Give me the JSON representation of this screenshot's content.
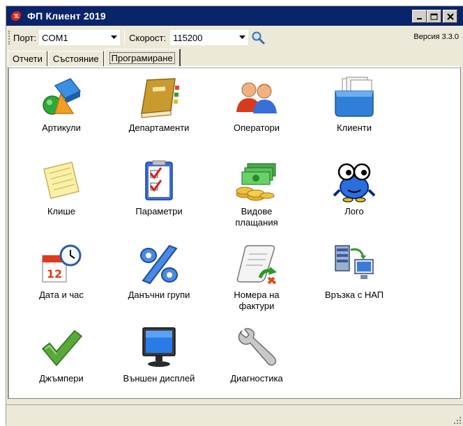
{
  "window": {
    "title": "ФП Клиент 2019"
  },
  "toolbar": {
    "port_label": "Порт:",
    "port_value": "COM1",
    "speed_label": "Скорост:",
    "speed_value": "115200",
    "version": "Версия 3.3.0"
  },
  "tabs": [
    {
      "label": "Отчети"
    },
    {
      "label": "Състояние"
    },
    {
      "label": "Програмиране"
    }
  ],
  "active_tab": "Програмиране",
  "items": [
    {
      "label": "Артикули",
      "icon": "shapes-icon"
    },
    {
      "label": "Департаменти",
      "icon": "book-icon"
    },
    {
      "label": "Оператори",
      "icon": "users-icon"
    },
    {
      "label": "Клиенти",
      "icon": "folder-files-icon"
    },
    {
      "label": "Клише",
      "icon": "notepad-icon"
    },
    {
      "label": "Параметри",
      "icon": "checklist-icon"
    },
    {
      "label": "Видове\nплащания",
      "icon": "money-icon"
    },
    {
      "label": "Лого",
      "icon": "mascot-icon"
    },
    {
      "label": "Дата и час",
      "icon": "calendar-clock-icon"
    },
    {
      "label": "Данъчни групи",
      "icon": "percent-icon"
    },
    {
      "label": "Номера на\nфактури",
      "icon": "scroll-icon"
    },
    {
      "label": "Връзка с НАП",
      "icon": "server-monitor-icon"
    },
    {
      "label": "Джъмпери",
      "icon": "checkmark-icon"
    },
    {
      "label": "Външен дисплей",
      "icon": "monitor-icon"
    },
    {
      "label": "Диагностика",
      "icon": "wrench-icon"
    }
  ]
}
